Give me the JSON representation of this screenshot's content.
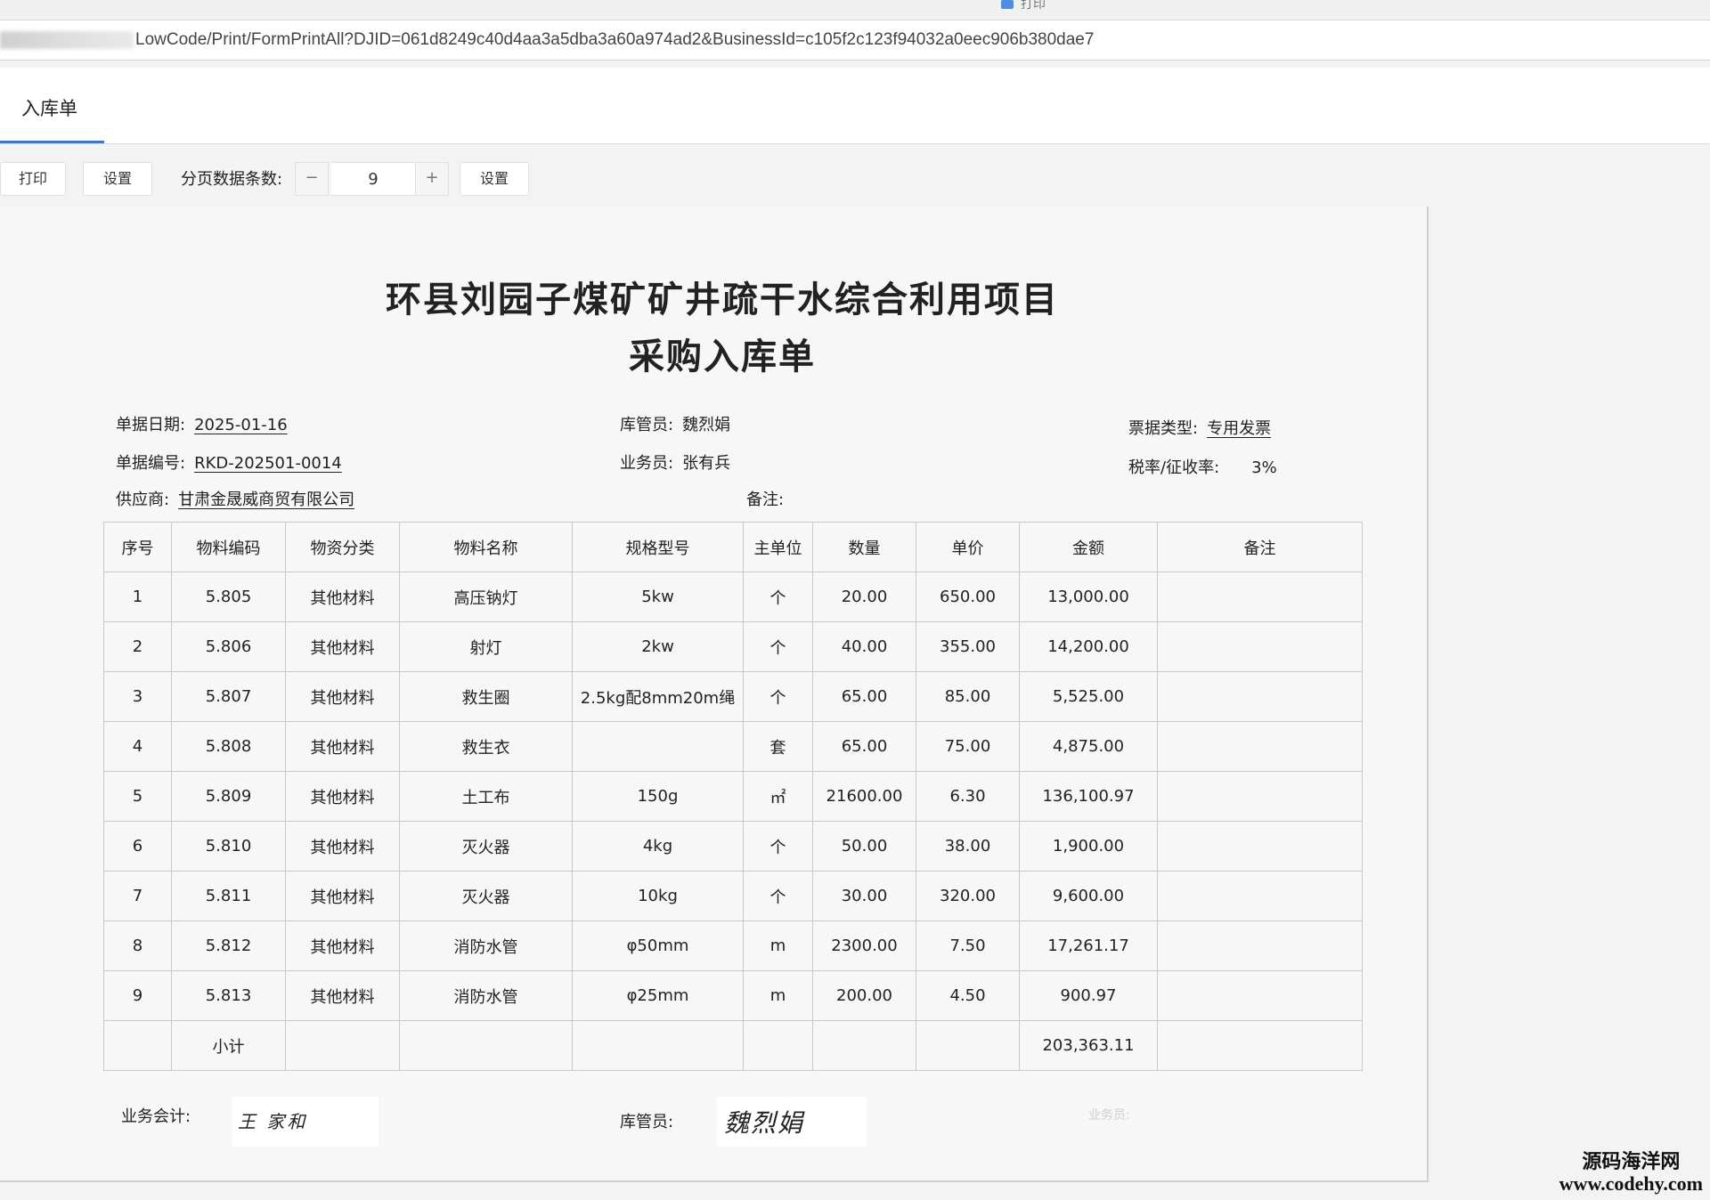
{
  "window": {
    "top_hint": "打印"
  },
  "address_bar": {
    "url": "LowCode/Print/FormPrintAll?DJID=061d8249c40d4aa3a5dba3a60a974ad2&BusinessId=c105f2c123f94032a0eec906b380dae7"
  },
  "tabs": [
    {
      "label": "入库单"
    }
  ],
  "toolbar": {
    "print_label": "打印",
    "settings_label": "设置",
    "page_size_label": "分页数据条数:",
    "minus": "−",
    "page_size_value": "9",
    "plus": "+",
    "settings2_label": "设置"
  },
  "document": {
    "title_line1": "环县刘园子煤矿矿井疏干水综合利用项目",
    "title_line2": "采购入库单",
    "info": {
      "date_label": "单据日期:",
      "date_value": "2025-01-16",
      "keeper_label": "库管员:",
      "keeper_value": "魏烈娟",
      "ticket_type_label": "票据类型:",
      "ticket_type_value": "专用发票",
      "number_label": "单据编号:",
      "number_value": "RKD-202501-0014",
      "salesman_label": "业务员:",
      "salesman_value": "张有兵",
      "tax_label": "税率/征收率:",
      "tax_value": "3%",
      "supplier_label": "供应商:",
      "supplier_value": "甘肃金晟威商贸有限公司",
      "remark_label": "备注:"
    },
    "table": {
      "headers": [
        "序号",
        "物料编码",
        "物资分类",
        "物料名称",
        "规格型号",
        "主单位",
        "数量",
        "单价",
        "金额",
        "备注"
      ],
      "rows": [
        [
          "1",
          "5.805",
          "其他材料",
          "高压钠灯",
          "5kw",
          "个",
          "20.00",
          "650.00",
          "13,000.00",
          ""
        ],
        [
          "2",
          "5.806",
          "其他材料",
          "射灯",
          "2kw",
          "个",
          "40.00",
          "355.00",
          "14,200.00",
          ""
        ],
        [
          "3",
          "5.807",
          "其他材料",
          "救生圈",
          "2.5kg配8mm20m绳",
          "个",
          "65.00",
          "85.00",
          "5,525.00",
          ""
        ],
        [
          "4",
          "5.808",
          "其他材料",
          "救生衣",
          "",
          "套",
          "65.00",
          "75.00",
          "4,875.00",
          ""
        ],
        [
          "5",
          "5.809",
          "其他材料",
          "土工布",
          "150g",
          "㎡",
          "21600.00",
          "6.30",
          "136,100.97",
          ""
        ],
        [
          "6",
          "5.810",
          "其他材料",
          "灭火器",
          "4kg",
          "个",
          "50.00",
          "38.00",
          "1,900.00",
          ""
        ],
        [
          "7",
          "5.811",
          "其他材料",
          "灭火器",
          "10kg",
          "个",
          "30.00",
          "320.00",
          "9,600.00",
          ""
        ],
        [
          "8",
          "5.812",
          "其他材料",
          "消防水管",
          "φ50mm",
          "m",
          "2300.00",
          "7.50",
          "17,261.17",
          ""
        ],
        [
          "9",
          "5.813",
          "其他材料",
          "消防水管",
          "φ25mm",
          "m",
          "200.00",
          "4.50",
          "900.97",
          ""
        ]
      ],
      "subtotal": [
        "",
        "小计",
        "",
        "",
        "",
        "",
        "",
        "",
        "203,363.11",
        ""
      ]
    },
    "signatures": {
      "accountant_label": "业务会计:",
      "accountant_sig": "王 家和",
      "keeper_label": "库管员:",
      "keeper_sig": "魏烈娟",
      "salesman_label": "业务员:"
    }
  },
  "brand": {
    "line1": "源码海洋网",
    "line2": "www.codehy.com"
  }
}
